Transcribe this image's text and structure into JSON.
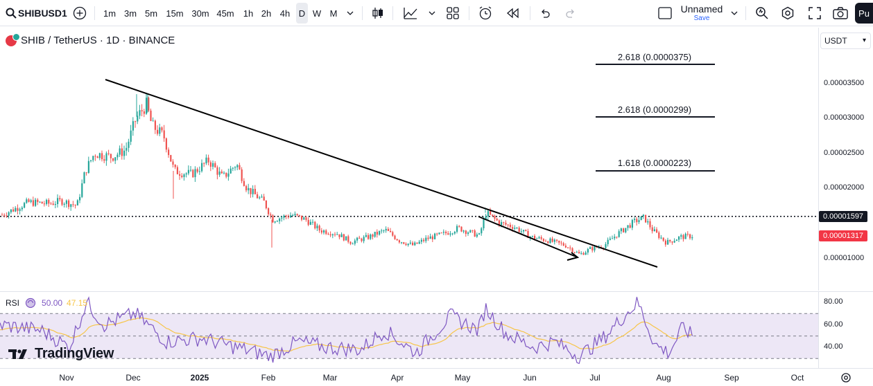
{
  "toolbar": {
    "symbol": "SHIBUSD1",
    "intervals": [
      "1m",
      "3m",
      "5m",
      "15m",
      "30m",
      "45m",
      "1h",
      "2h",
      "4h",
      "D",
      "W",
      "M"
    ],
    "active_interval": "D",
    "layout_name": "Unnamed",
    "save_label": "Save",
    "publish_label": "Pu"
  },
  "legend": {
    "title": "SHIB / TetherUS · 1D · BINANCE"
  },
  "currency": "USDT",
  "price_scale": {
    "ticks": [
      "0.00003500",
      "0.00003000",
      "0.00002500",
      "0.00002000",
      "0.00001000"
    ],
    "level_tag": "0.00001597",
    "last_price_tag": "0.00001317"
  },
  "fib_labels": [
    "2.618 (0.0000375)",
    "2.618 (0.0000299)",
    "1.618 (0.0000223)"
  ],
  "rsi": {
    "name": "RSI",
    "value1": "50.00",
    "value2": "47.15",
    "ticks": [
      "80.00",
      "60.00",
      "40.00"
    ]
  },
  "time_axis": [
    "Nov",
    "Dec",
    "2025",
    "Feb",
    "Mar",
    "Apr",
    "May",
    "Jun",
    "Jul",
    "Aug",
    "Sep",
    "Oct"
  ],
  "branding": "TradingView",
  "colors": {
    "up": "#26a69a",
    "down": "#ef5350",
    "rsi_line": "#7e57c2",
    "rsi_ma": "#f7c548",
    "rsi_band": "#ede7f6",
    "last_price": "#f23645"
  },
  "chart_data": {
    "type": "candlestick",
    "title": "SHIB / TetherUS · 1D · BINANCE",
    "x_range": [
      "Oct 2024",
      "Oct 2025"
    ],
    "y_range": [
      8.5e-06,
      3.9e-05
    ],
    "last_close": 1.317e-05,
    "horizontal_level": 1.597e-05,
    "fib_levels": [
      {
        "label": "2.618",
        "value": 3.75e-05
      },
      {
        "label": "2.618",
        "value": 2.99e-05
      },
      {
        "label": "1.618",
        "value": 2.23e-05
      }
    ],
    "trendline": {
      "from": {
        "date": "mid Nov 2024",
        "value": 3.55e-05
      },
      "to": {
        "date": "early Jul 2025",
        "value": 9.7e-06
      }
    },
    "monthly_approx": [
      {
        "month": "Nov",
        "close": 2.45e-05
      },
      {
        "month": "Dec",
        "close": 2.25e-05
      },
      {
        "month": "Jan",
        "close": 1.95e-05
      },
      {
        "month": "Feb",
        "close": 1.55e-05
      },
      {
        "month": "Mar",
        "close": 1.3e-05
      },
      {
        "month": "Apr",
        "close": 1.35e-05
      },
      {
        "month": "May",
        "close": 1.45e-05
      },
      {
        "month": "Jun",
        "close": 1.12e-05
      },
      {
        "month": "Jul",
        "close": 1.4e-05
      },
      {
        "month": "Aug",
        "close": 1.32e-05
      }
    ],
    "rsi_range": [
      20,
      90
    ],
    "rsi_bands": [
      70,
      50,
      30
    ]
  }
}
